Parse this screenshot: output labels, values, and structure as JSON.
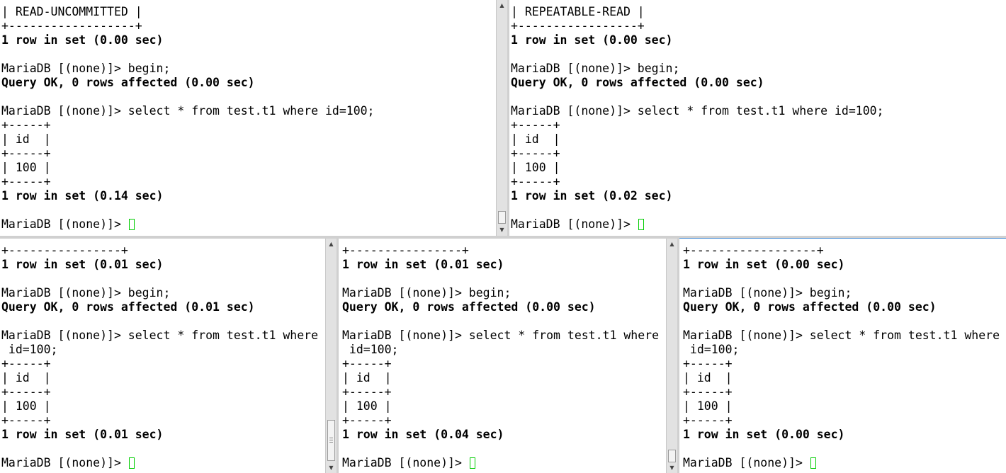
{
  "panes": [
    {
      "lines": [
        {
          "text": "| READ-UNCOMMITTED |",
          "bold": false
        },
        {
          "text": "+------------------+",
          "bold": false
        },
        {
          "text": "1 row in set (0.00 sec)",
          "bold": true
        },
        {
          "text": "",
          "bold": false
        },
        {
          "text": "MariaDB [(none)]> begin;",
          "bold": false
        },
        {
          "text": "Query OK, 0 rows affected (0.00 sec)",
          "bold": true
        },
        {
          "text": "",
          "bold": false
        },
        {
          "text": "MariaDB [(none)]> select * from test.t1 where id=100;",
          "bold": false
        },
        {
          "text": "+-----+",
          "bold": false
        },
        {
          "text": "| id  |",
          "bold": false
        },
        {
          "text": "+-----+",
          "bold": false
        },
        {
          "text": "| 100 |",
          "bold": false
        },
        {
          "text": "+-----+",
          "bold": false
        },
        {
          "text": "1 row in set (0.14 sec)",
          "bold": true
        },
        {
          "text": "",
          "bold": false
        }
      ],
      "prompt": "MariaDB [(none)]> "
    },
    {
      "lines": [
        {
          "text": "| REPEATABLE-READ |",
          "bold": false
        },
        {
          "text": "+-----------------+",
          "bold": false
        },
        {
          "text": "1 row in set (0.00 sec)",
          "bold": true
        },
        {
          "text": "",
          "bold": false
        },
        {
          "text": "MariaDB [(none)]> begin;",
          "bold": false
        },
        {
          "text": "Query OK, 0 rows affected (0.00 sec)",
          "bold": true
        },
        {
          "text": "",
          "bold": false
        },
        {
          "text": "MariaDB [(none)]> select * from test.t1 where id=100;",
          "bold": false
        },
        {
          "text": "+-----+",
          "bold": false
        },
        {
          "text": "| id  |",
          "bold": false
        },
        {
          "text": "+-----+",
          "bold": false
        },
        {
          "text": "| 100 |",
          "bold": false
        },
        {
          "text": "+-----+",
          "bold": false
        },
        {
          "text": "1 row in set (0.02 sec)",
          "bold": true
        },
        {
          "text": "",
          "bold": false
        }
      ],
      "prompt": "MariaDB [(none)]> "
    },
    {
      "lines": [
        {
          "text": "+----------------+",
          "bold": false
        },
        {
          "text": "1 row in set (0.01 sec)",
          "bold": true
        },
        {
          "text": "",
          "bold": false
        },
        {
          "text": "MariaDB [(none)]> begin;",
          "bold": false
        },
        {
          "text": "Query OK, 0 rows affected (0.01 sec)",
          "bold": true
        },
        {
          "text": "",
          "bold": false
        },
        {
          "text": "MariaDB [(none)]> select * from test.t1 where",
          "bold": false
        },
        {
          "text": " id=100;",
          "bold": false
        },
        {
          "text": "+-----+",
          "bold": false
        },
        {
          "text": "| id  |",
          "bold": false
        },
        {
          "text": "+-----+",
          "bold": false
        },
        {
          "text": "| 100 |",
          "bold": false
        },
        {
          "text": "+-----+",
          "bold": false
        },
        {
          "text": "1 row in set (0.01 sec)",
          "bold": true
        },
        {
          "text": "",
          "bold": false
        }
      ],
      "prompt": "MariaDB [(none)]> "
    },
    {
      "lines": [
        {
          "text": "+----------------+",
          "bold": false
        },
        {
          "text": "1 row in set (0.01 sec)",
          "bold": true
        },
        {
          "text": "",
          "bold": false
        },
        {
          "text": "MariaDB [(none)]> begin;",
          "bold": false
        },
        {
          "text": "Query OK, 0 rows affected (0.00 sec)",
          "bold": true
        },
        {
          "text": "",
          "bold": false
        },
        {
          "text": "MariaDB [(none)]> select * from test.t1 where",
          "bold": false
        },
        {
          "text": " id=100;",
          "bold": false
        },
        {
          "text": "+-----+",
          "bold": false
        },
        {
          "text": "| id  |",
          "bold": false
        },
        {
          "text": "+-----+",
          "bold": false
        },
        {
          "text": "| 100 |",
          "bold": false
        },
        {
          "text": "+-----+",
          "bold": false
        },
        {
          "text": "1 row in set (0.04 sec)",
          "bold": true
        },
        {
          "text": "",
          "bold": false
        }
      ],
      "prompt": "MariaDB [(none)]> "
    },
    {
      "lines": [
        {
          "text": "+------------------+",
          "bold": false
        },
        {
          "text": "1 row in set (0.00 sec)",
          "bold": true
        },
        {
          "text": "",
          "bold": false
        },
        {
          "text": "MariaDB [(none)]> begin;",
          "bold": false
        },
        {
          "text": "Query OK, 0 rows affected (0.00 sec)",
          "bold": true
        },
        {
          "text": "",
          "bold": false
        },
        {
          "text": "MariaDB [(none)]> select * from test.t1 where",
          "bold": false
        },
        {
          "text": " id=100;",
          "bold": false
        },
        {
          "text": "+-----+",
          "bold": false
        },
        {
          "text": "| id  |",
          "bold": false
        },
        {
          "text": "+-----+",
          "bold": false
        },
        {
          "text": "| 100 |",
          "bold": false
        },
        {
          "text": "+-----+",
          "bold": false
        },
        {
          "text": "1 row in set (0.00 sec)",
          "bold": true
        },
        {
          "text": "",
          "bold": false
        }
      ],
      "prompt": "MariaDB [(none)]> "
    }
  ],
  "colors": {
    "background": "#ffffff",
    "text": "#000000",
    "cursor": "#00cc00",
    "active_pane_border": "#4a90d9"
  },
  "icons": {
    "scroll_up": "triangle-up-icon",
    "scroll_down": "triangle-down-icon"
  }
}
